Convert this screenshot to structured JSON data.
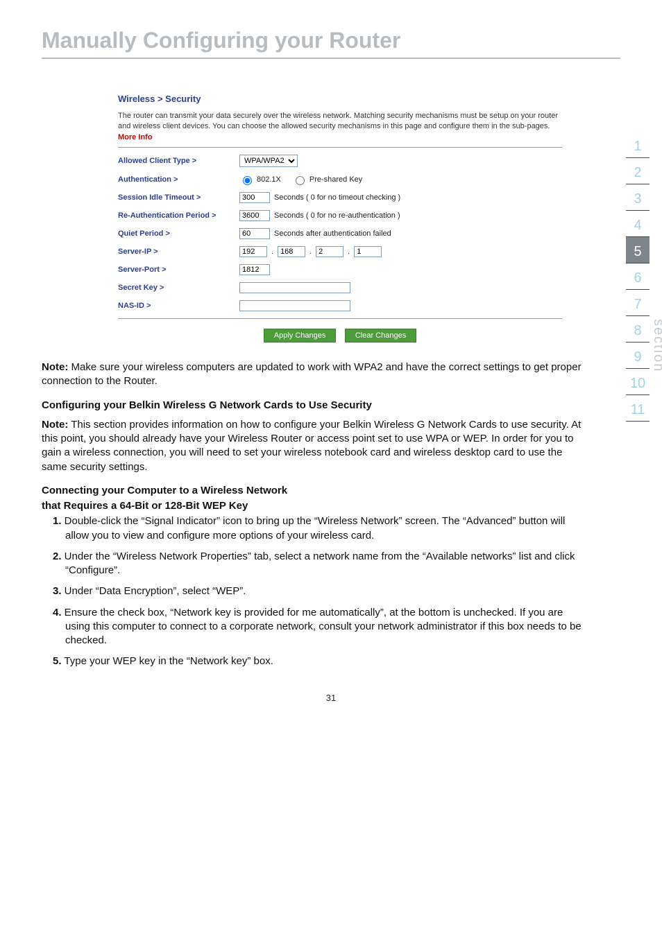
{
  "page": {
    "title": "Manually Configuring your Router",
    "number": "31"
  },
  "side_nav": {
    "items": [
      "1",
      "2",
      "3",
      "4",
      "5",
      "6",
      "7",
      "8",
      "9",
      "10",
      "11"
    ],
    "active_index": 4,
    "label": "section"
  },
  "router_panel": {
    "crumb": "Wireless > Security",
    "desc_main": "The router can transmit your data securely over the wireless network. Matching security mechanisms must be setup on your router and wireless client devices. You can choose the allowed security mechanisms in this page and configure them in the sub-pages. ",
    "desc_more": "More Info",
    "rows": {
      "allowed_client_type": {
        "label": "Allowed Client Type >",
        "value": "WPA/WPA2"
      },
      "authentication": {
        "label": "Authentication >",
        "opt1": "802.1X",
        "opt2": "Pre-shared Key"
      },
      "session_timeout": {
        "label": "Session Idle Timeout >",
        "value": "300",
        "hint": "Seconds ( 0 for no timeout checking )"
      },
      "reauth": {
        "label": "Re-Authentication Period >",
        "value": "3600",
        "hint": "Seconds ( 0 for no re-authentication )"
      },
      "quiet": {
        "label": "Quiet Period >",
        "value": "60",
        "hint": "Seconds after authentication failed"
      },
      "server_ip": {
        "label": "Server-IP >",
        "a": "192",
        "b": "168",
        "c": "2",
        "d": "1"
      },
      "server_port": {
        "label": "Server-Port >",
        "value": "1812"
      },
      "secret_key": {
        "label": "Secret Key >",
        "value": ""
      },
      "nas_id": {
        "label": "NAS-ID >",
        "value": ""
      }
    },
    "btn_apply": "Apply Changes",
    "btn_clear": "Clear Changes"
  },
  "doc": {
    "note1_label": "Note:",
    "note1_text": " Make sure your wireless computers are updated to work with WPA2 and have the correct settings to get proper connection to the Router.",
    "h1": "Configuring your Belkin Wireless G Network Cards to Use Security",
    "note2_label": "Note:",
    "note2_text": " This section provides information on how to configure your Belkin Wireless G Network Cards to use security. At this point, you should already have your Wireless Router or access point set to use WPA or WEP. In order for you to gain a wireless connection, you will need to set your wireless notebook card and wireless desktop card to use the same security settings.",
    "h2a": "Connecting your Computer to a Wireless Network",
    "h2b": "that Requires a 64-Bit or 128-Bit WEP Key",
    "steps": [
      {
        "n": "1.",
        "t": " Double-click the “Signal Indicator” icon to bring up the “Wireless Network” screen. The “Advanced” button will allow you to view and configure more options of your wireless card."
      },
      {
        "n": "2.",
        "t": " Under the “Wireless Network Properties” tab, select a network name from the “Available networks” list and click “Configure”."
      },
      {
        "n": "3.",
        "t": " Under “Data Encryption”, select “WEP”."
      },
      {
        "n": "4.",
        "t": " Ensure the check box, “Network key is provided for me automatically”, at the bottom is unchecked. If you are using this computer to connect to a corporate network, consult your network administrator if this box needs to be checked."
      },
      {
        "n": "5.",
        "t": " Type your WEP key in the “Network key” box."
      }
    ]
  }
}
